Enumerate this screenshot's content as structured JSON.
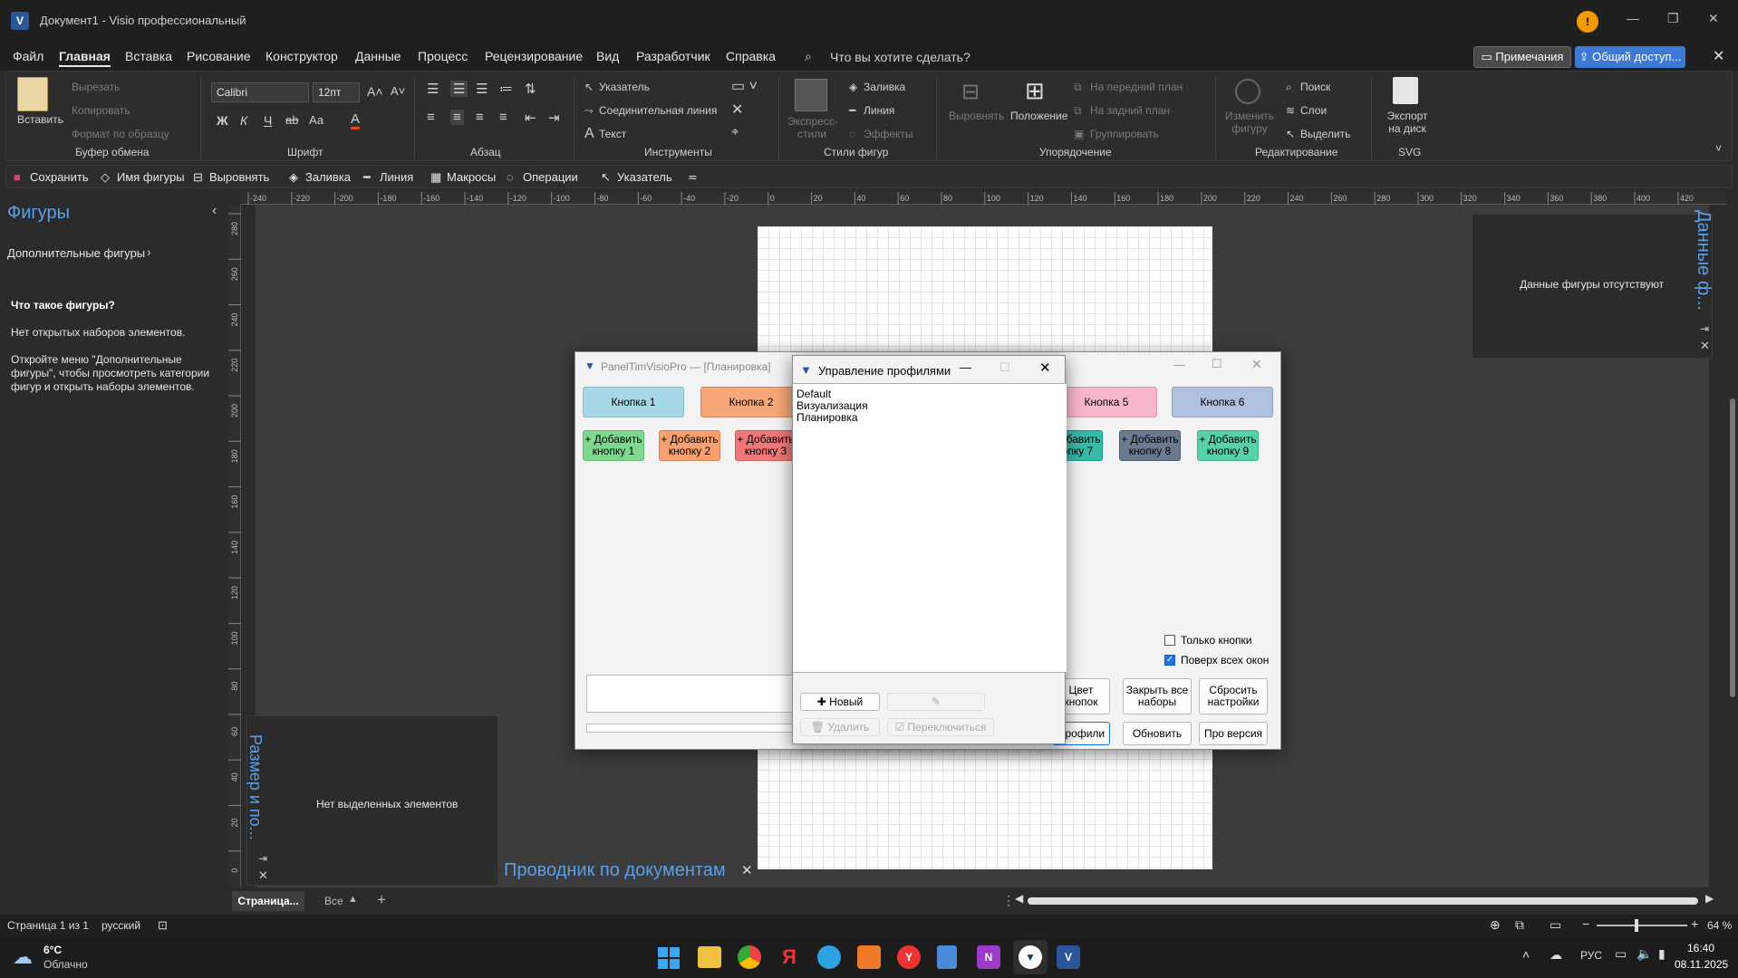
{
  "window": {
    "title": "Документ1 - Visio профессиональный",
    "app_icon": "V",
    "logo_glyph": "!"
  },
  "menu": {
    "items": [
      "Файл",
      "Главная",
      "Вставка",
      "Рисование",
      "Конструктор",
      "Данные",
      "Процесс",
      "Рецензирование",
      "Вид",
      "Разработчик",
      "Справка"
    ],
    "search_placeholder": "Что вы хотите сделать?",
    "comments_label": "Примечания",
    "share_label": "Общий доступ..."
  },
  "ribbon": {
    "paste": "Вставить",
    "cut": "Вырезать",
    "copy": "Копировать",
    "format_painter": "Формат по образцу",
    "clipboard_group": "Буфер обмена",
    "font_name": "Calibri",
    "font_size": "12пт",
    "bold": "Ж",
    "italic": "К",
    "underline": "Ч",
    "strike": "аb",
    "case": "Аа",
    "font_color": "А",
    "font_group": "Шрифт",
    "paragraph_group": "Абзац",
    "pointer": "Указатель",
    "connector": "Соединительная линия",
    "text": "Текст",
    "tools_group": "Инструменты",
    "express_styles": "Экспресс-стили",
    "fill": "Заливка",
    "line": "Линия",
    "effects": "Эффекты",
    "shape_styles_group": "Стили фигур",
    "align": "Выровнять",
    "position": "Положение",
    "bring_front": "На передний план",
    "send_back": "На задний план",
    "group": "Группировать",
    "arrange_group": "Упорядочение",
    "change_shape": "Изменить фигуру",
    "find": "Поиск",
    "layers": "Слои",
    "select": "Выделить",
    "editing_group": "Редактирование",
    "export": "Экспорт на диск",
    "svg_group": "SVG"
  },
  "qat": {
    "save": "Сохранить",
    "shape_name": "Имя фигуры",
    "align": "Выровнять",
    "fill": "Заливка",
    "line": "Линия",
    "macros": "Макросы",
    "operations": "Операции",
    "pointer": "Указатель"
  },
  "shapes_pane": {
    "title": "Фигуры",
    "more_shapes": "Дополнительные фигуры",
    "what_title": "Что такое фигуры?",
    "no_stencils": "Нет открытых наборов элементов.",
    "hint": "Откройте меню \"Дополнительные фигуры\", чтобы просмотреть категории фигур и открыть наборы элементов."
  },
  "ruler_h": [
    "-240",
    "-220",
    "-200",
    "-180",
    "-160",
    "-140",
    "-120",
    "-100",
    "-80",
    "-60",
    "-40",
    "-20",
    "0",
    "20",
    "40",
    "60",
    "80",
    "100",
    "120",
    "140",
    "160",
    "180",
    "200",
    "220",
    "240",
    "260",
    "280",
    "300",
    "320",
    "340",
    "360",
    "380",
    "400",
    "420"
  ],
  "ruler_v": [
    "280",
    "260",
    "240",
    "220",
    "200",
    "180",
    "160",
    "140",
    "120",
    "100",
    "80",
    "60",
    "40",
    "20",
    "0"
  ],
  "size_pane": {
    "title": "Размер и по...",
    "empty": "Нет выделенных элементов"
  },
  "doc_explorer": {
    "title": "Проводник по документам"
  },
  "data_pane": {
    "title": "Данные ф...",
    "empty": "Данные фигуры отсутствуют"
  },
  "panel_window": {
    "title": "PanelTimVisioPro — [Планировка]",
    "buttons": [
      {
        "label": "Кнопка 1",
        "color": "#a8d8e8"
      },
      {
        "label": "Кнопка 2",
        "color": "#f8a878"
      },
      {
        "label": "Кнопка 5",
        "color": "#f8b8c8"
      },
      {
        "label": "Кнопка 6",
        "color": "#b0c0e0"
      }
    ],
    "add_buttons": [
      {
        "label": "+ Добавить кнопку 1",
        "color": "#7ed890"
      },
      {
        "label": "+ Добавить кнопку 2",
        "color": "#f8a070"
      },
      {
        "label": "+ Добавить кнопку 3",
        "color": "#f07878"
      },
      {
        "label": "+ Добавить кнопку 7",
        "color": "#38b8a8"
      },
      {
        "label": "+ Добавить кнопку 8",
        "color": "#6c7a90"
      },
      {
        "label": "+ Добавить кнопку 9",
        "color": "#58d0a8"
      }
    ],
    "only_buttons": "Только кнопки",
    "on_top": "Поверх всех окон",
    "on_top_checked": true,
    "color_buttons": "Цвет кнопок",
    "close_sets": "Закрыть все наборы",
    "reset": "Сбросить настройки",
    "profiles": "Профили",
    "refresh": "Обновить",
    "pro": "Про версия"
  },
  "profiles_window": {
    "title": "Управление профилями",
    "items": [
      "Default",
      "Визуализация",
      "Планировка"
    ],
    "new": "Новый",
    "delete": "Удалить",
    "switch": "Переключиться"
  },
  "page_tabs": {
    "current": "Страница...",
    "all": "Все"
  },
  "status": {
    "page": "Страница 1 из 1",
    "language": "русский",
    "zoom": "64 %"
  },
  "taskbar": {
    "temp": "6°C",
    "weather": "Облачно",
    "lang": "РУС",
    "time": "16:40",
    "date": "08.11.2025"
  }
}
